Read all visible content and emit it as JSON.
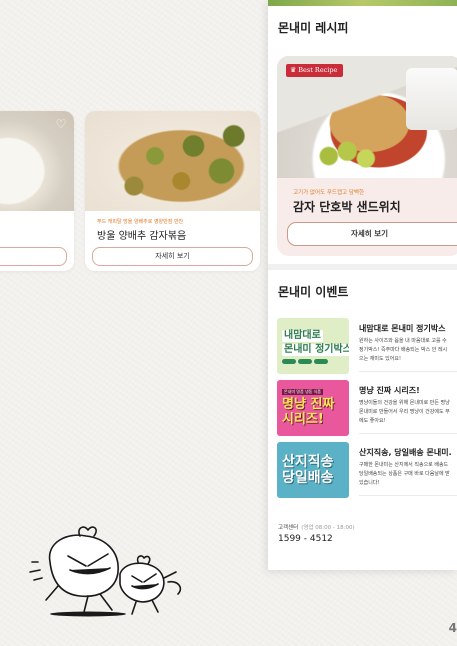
{
  "left_carousel": {
    "cards": [
      {
        "subtitle": "",
        "title": "",
        "button_label": "기"
      },
      {
        "subtitle": "푸드 캐피탈 방울 양배추로 영양만점 반찬",
        "title": "방울 양배추 감자볶음",
        "button_label": "자세히 보기"
      }
    ]
  },
  "recipe_section": {
    "title": "몬내미 레시피",
    "badge": "Best Recipe",
    "featured": {
      "subtitle": "고기가 없어도 푸드캡고 담백한",
      "name": "감자 단호박 샌드위치",
      "button_label": "자세히 보기"
    }
  },
  "event_section": {
    "title": "몬내미 이벤트",
    "events": [
      {
        "thumb_lines": [
          "내맘대로",
          "몬내미 정기박스"
        ],
        "title": "내맘대로 몬내미 정기박스",
        "desc_lines": [
          "원하는 사이즈와 옵을 내 마음대로 고를 수",
          "정기박스! 즉주마다 배송되는 박스 안 레시",
          "으는 재미도 있어요!"
        ]
      },
      {
        "thumb_small": "몬내미 명품 냉동 식품",
        "thumb_lines": [
          "명냥 진짜",
          "시리즈!"
        ],
        "title": "명냥 진짜 시리즈!",
        "desc_lines": [
          "명냥이들의 건강을 위해 몬내미로 만든 명냥",
          "몬내미로 만들어서 우리 명냥이 건강에도 무",
          "에도 좋아요!"
        ]
      },
      {
        "thumb_lines": [
          "산지직송",
          "당일배송"
        ],
        "title": "산지직송, 당일배송 몬내미.",
        "desc_lines": [
          "구매한 몬내미는 산지에서 직송으로 배송드",
          "당일배송되는 상품은 구매 바로 다음날에 받",
          "있습니다!"
        ]
      }
    ]
  },
  "customer_center": {
    "label": "고객센터",
    "hours": "(영업 08:00 - 18:00)",
    "phone": "1599 - 4512"
  },
  "page_number": "4"
}
